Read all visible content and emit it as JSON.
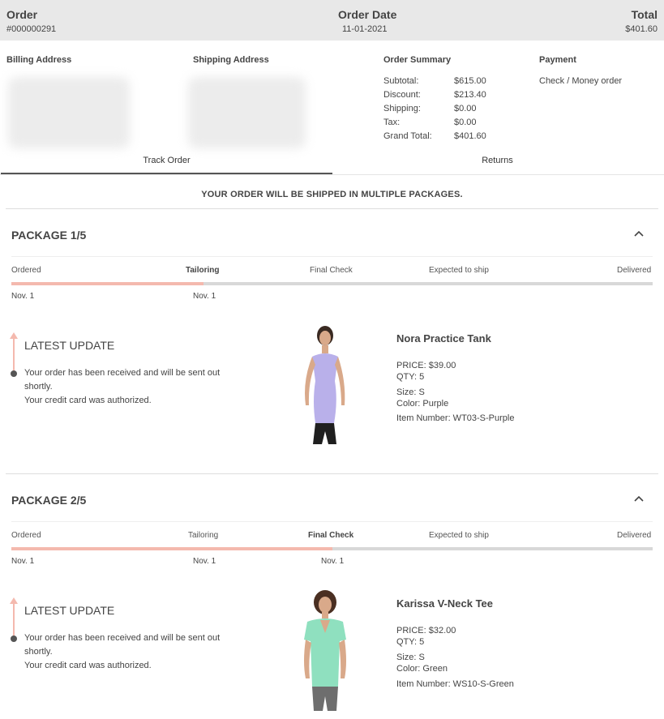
{
  "header": {
    "order_label": "Order",
    "order_number": "#000000291",
    "date_label": "Order Date",
    "date_value": "11-01-2021",
    "total_label": "Total",
    "total_value": "$401.60"
  },
  "billing": {
    "title": "Billing Address"
  },
  "shipping": {
    "title": "Shipping Address"
  },
  "summary": {
    "title": "Order Summary",
    "rows": [
      {
        "label": "Subtotal:",
        "value": "$615.00"
      },
      {
        "label": "Discount:",
        "value": "$213.40"
      },
      {
        "label": "Shipping:",
        "value": "$0.00"
      },
      {
        "label": "Tax:",
        "value": "$0.00"
      },
      {
        "label": "Grand Total:",
        "value": "$401.60"
      }
    ]
  },
  "payment": {
    "title": "Payment",
    "method": "Check / Money order"
  },
  "tabs": [
    {
      "label": "Track Order",
      "active": true
    },
    {
      "label": "Returns",
      "active": false
    }
  ],
  "notice": "YOUR ORDER WILL BE SHIPPED IN MULTIPLE PACKAGES.",
  "colors": {
    "progress_fill": "#f4b9ae",
    "progress_track": "#d8d8d8",
    "header_bg": "#e8e8e8"
  },
  "packages": [
    {
      "title": "PACKAGE 1/5",
      "steps": [
        "Ordered",
        "Tailoring",
        "Final Check",
        "Expected to ship",
        "Delivered"
      ],
      "current_step": "Tailoring",
      "progress_percent": 30,
      "dates": [
        "Nov. 1",
        "Nov. 1"
      ],
      "update_title": "LATEST UPDATE",
      "update_lines": [
        "Your order has been received and will be sent out shortly.",
        "Your credit card was authorized."
      ],
      "product": {
        "name": "Nora Practice Tank",
        "price": "PRICE: $39.00",
        "qty": "QTY: 5",
        "size": "Size: S",
        "color": "Color: Purple",
        "item_number": "Item Number: WT03-S-Purple"
      }
    },
    {
      "title": "PACKAGE 2/5",
      "steps": [
        "Ordered",
        "Tailoring",
        "Final Check",
        "Expected to ship",
        "Delivered"
      ],
      "current_step": "Final Check",
      "progress_percent": 50,
      "dates": [
        "Nov. 1",
        "Nov. 1",
        "Nov. 1"
      ],
      "update_title": "LATEST UPDATE",
      "update_lines": [
        "Your order has been received and will be sent out shortly.",
        "Your credit card was authorized."
      ],
      "product": {
        "name": "Karissa V-Neck Tee",
        "price": "PRICE: $32.00",
        "qty": "QTY: 5",
        "size": "Size: S",
        "color": "Color: Green",
        "item_number": "Item Number: WS10-S-Green"
      }
    }
  ]
}
